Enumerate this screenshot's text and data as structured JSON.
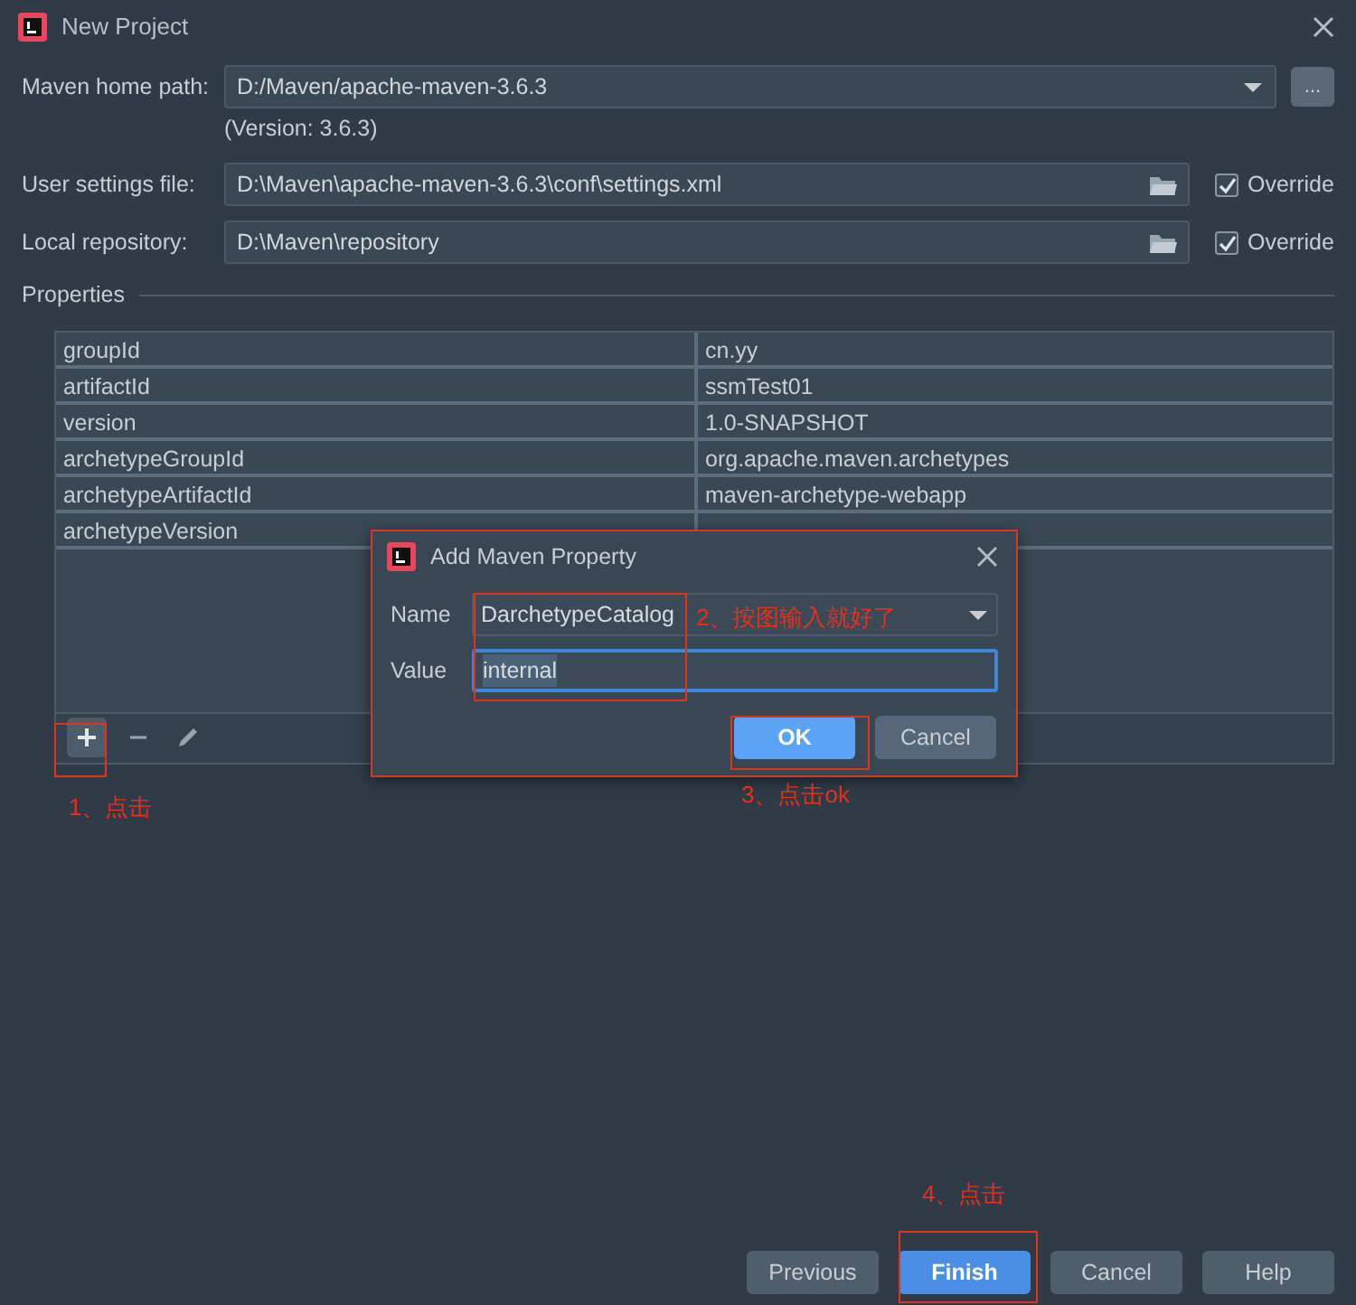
{
  "window": {
    "title": "New Project"
  },
  "maven_home_path": {
    "label": "Maven home path:",
    "value": "D:/Maven/apache-maven-3.6.3",
    "browse_button": "...",
    "version": "(Version: 3.6.3)"
  },
  "user_settings_file": {
    "label": "User settings file:",
    "value": "D:\\Maven\\apache-maven-3.6.3\\conf\\settings.xml",
    "override": {
      "label": "Override",
      "checked": true
    }
  },
  "local_repository": {
    "label": "Local repository:",
    "value": "D:\\Maven\\repository",
    "override": {
      "label": "Override",
      "checked": true
    }
  },
  "properties": {
    "title": "Properties",
    "rows": [
      {
        "key": "groupId",
        "value": "cn.yy"
      },
      {
        "key": "artifactId",
        "value": "ssmTest01"
      },
      {
        "key": "version",
        "value": "1.0-SNAPSHOT"
      },
      {
        "key": "archetypeGroupId",
        "value": "org.apache.maven.archetypes"
      },
      {
        "key": "archetypeArtifactId",
        "value": "maven-archetype-webapp"
      },
      {
        "key": "archetypeVersion"
      }
    ]
  },
  "dialog": {
    "title": "Add Maven Property",
    "name": {
      "label": "Name",
      "value": "DarchetypeCatalog"
    },
    "value": {
      "label": "Value",
      "value": "internal"
    },
    "buttons": [
      {
        "label": "OK",
        "default": true
      },
      {
        "label": "Cancel",
        "default": false
      }
    ]
  },
  "buttons": [
    {
      "label": "Previous",
      "default": false
    },
    {
      "label": "Finish",
      "default": true
    },
    {
      "label": "Cancel",
      "default": false
    },
    {
      "label": "Help",
      "default": false
    }
  ],
  "annotations": [
    "1、点击",
    "2、按图输入就好了",
    "3、点击ok",
    "4、点击"
  ]
}
